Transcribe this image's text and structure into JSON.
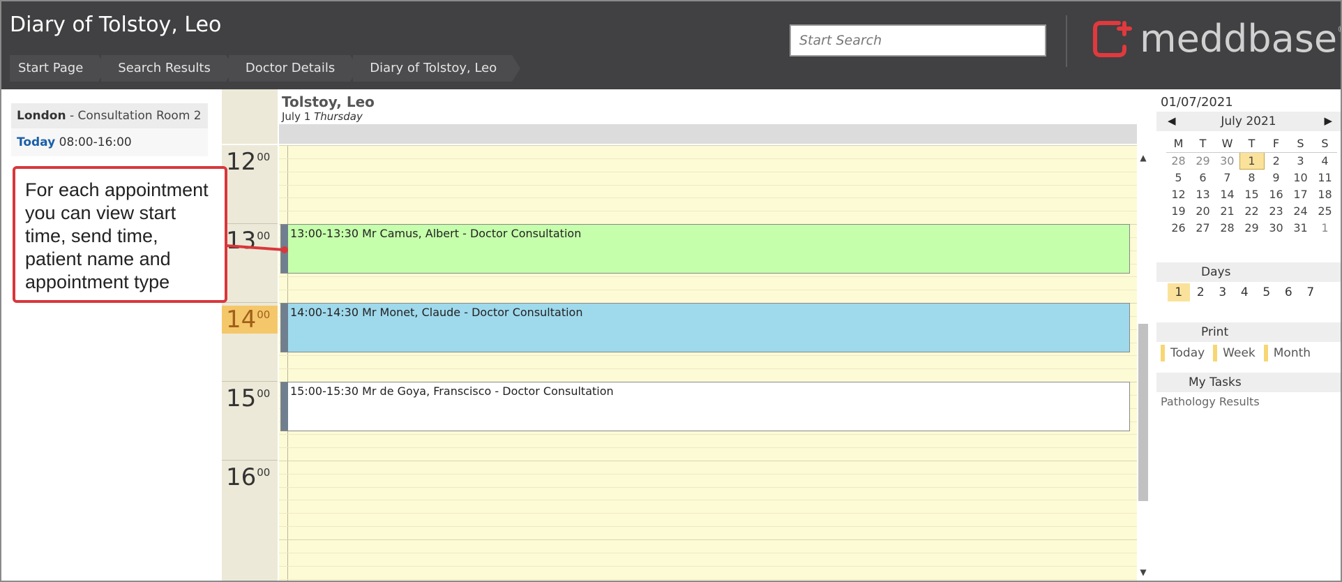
{
  "header": {
    "title": "Diary of Tolstoy, Leo",
    "breadcrumb": [
      "Start Page",
      "Search Results",
      "Doctor Details",
      "Diary of Tolstoy, Leo"
    ],
    "search_placeholder": "Start Search",
    "logo_text": "meddbase",
    "logo_reg": "®"
  },
  "left_panel": {
    "location_bold": "London",
    "location_rest": " - Consultation Room 2",
    "today_label": "Today",
    "today_hours": " 08:00-16:00"
  },
  "callout": {
    "text": "For each appointment you can view start time, send time, patient name and appointment type"
  },
  "diary": {
    "doctor": "Tolstoy, Leo",
    "date": "July 1",
    "weekday": "Thursday",
    "hours": [
      {
        "h": "12",
        "m": "00"
      },
      {
        "h": "13",
        "m": "00"
      },
      {
        "h": "14",
        "m": "00",
        "current": true
      },
      {
        "h": "15",
        "m": "00"
      },
      {
        "h": "16",
        "m": "00"
      }
    ],
    "appointments": [
      {
        "text": "13:00-13:30 Mr Camus, Albert - Doctor Consultation",
        "color": "#c6ffab"
      },
      {
        "text": "14:00-14:30 Mr Monet, Claude - Doctor Consultation",
        "color": "#9fd9ec"
      },
      {
        "text": "15:00-15:30 Mr de Goya, Franscisco - Doctor Consultation",
        "color": "#ffffff"
      }
    ],
    "scroll_up": "▲",
    "scroll_down": "▼"
  },
  "right_panel": {
    "selected_date": "01/07/2021",
    "month_label": "July 2021",
    "prev": "◀",
    "next": "▶",
    "weekdays": [
      "M",
      "T",
      "W",
      "T",
      "F",
      "S",
      "S"
    ],
    "weeks": [
      [
        {
          "d": "28",
          "o": true
        },
        {
          "d": "29",
          "o": true
        },
        {
          "d": "30",
          "o": true
        },
        {
          "d": "1",
          "sel": true
        },
        {
          "d": "2"
        },
        {
          "d": "3"
        },
        {
          "d": "4"
        }
      ],
      [
        {
          "d": "5"
        },
        {
          "d": "6"
        },
        {
          "d": "7"
        },
        {
          "d": "8"
        },
        {
          "d": "9"
        },
        {
          "d": "10"
        },
        {
          "d": "11"
        }
      ],
      [
        {
          "d": "12"
        },
        {
          "d": "13"
        },
        {
          "d": "14"
        },
        {
          "d": "15"
        },
        {
          "d": "16"
        },
        {
          "d": "17"
        },
        {
          "d": "18"
        }
      ],
      [
        {
          "d": "19"
        },
        {
          "d": "20"
        },
        {
          "d": "21"
        },
        {
          "d": "22"
        },
        {
          "d": "23"
        },
        {
          "d": "24"
        },
        {
          "d": "25"
        }
      ],
      [
        {
          "d": "26"
        },
        {
          "d": "27"
        },
        {
          "d": "28"
        },
        {
          "d": "29"
        },
        {
          "d": "30"
        },
        {
          "d": "31"
        },
        {
          "d": "1",
          "o": true
        }
      ]
    ],
    "days_heading": "Days",
    "days": [
      "1",
      "2",
      "3",
      "4",
      "5",
      "6",
      "7"
    ],
    "days_active": "1",
    "print_heading": "Print",
    "print_options": [
      "Today",
      "Week",
      "Month"
    ],
    "tasks_heading": "My Tasks",
    "task": "Pathology Results"
  },
  "colors": {
    "header_bg": "#414042",
    "logo_red": "#e0393e",
    "day_bg": "#fdfbd6",
    "current_hour": "#f5c76b",
    "callout_border": "#d9373b"
  }
}
